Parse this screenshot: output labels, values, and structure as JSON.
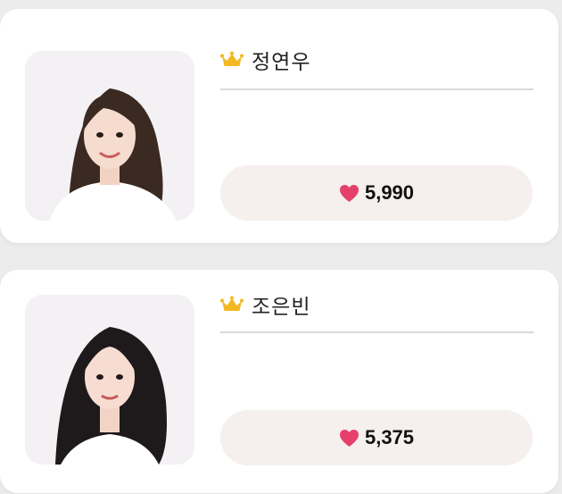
{
  "background_color": "#ececec",
  "accent_colors": {
    "crown": "#f2b824",
    "heart": "#e5406a",
    "button_bg": "#f5efee"
  },
  "cards": [
    {
      "name": "정연우",
      "rank_icon": "crown-icon",
      "like_icon": "heart-icon",
      "likes": "5,990"
    },
    {
      "name": "조은빈",
      "rank_icon": "crown-icon",
      "like_icon": "heart-icon",
      "likes": "5,375"
    }
  ]
}
